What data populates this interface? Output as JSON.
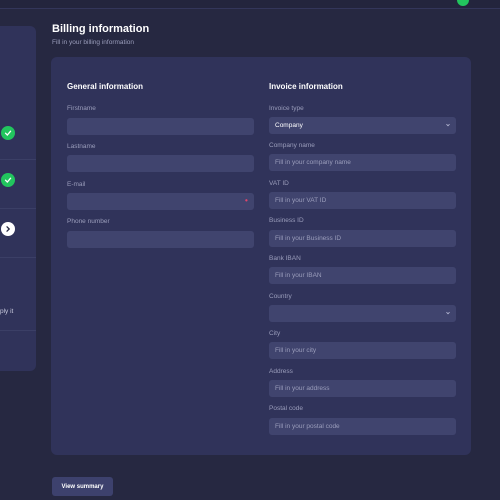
{
  "header": {
    "title": "Billing information",
    "subtitle": "Fill in your billing information"
  },
  "steps_panel": {
    "partial_text": "ply it"
  },
  "general": {
    "title": "General information",
    "fields": [
      {
        "label": "Firstname",
        "value": ""
      },
      {
        "label": "Lastname",
        "value": ""
      },
      {
        "label": "E-mail",
        "value": ""
      },
      {
        "label": "Phone number",
        "value": ""
      }
    ]
  },
  "invoice": {
    "title": "Invoice information",
    "invoice_type": {
      "label": "Invoice type",
      "value": "Company"
    },
    "company_name": {
      "label": "Company name",
      "placeholder": "Fill in your company name"
    },
    "vat_id": {
      "label": "VAT ID",
      "placeholder": "Fill in your VAT ID"
    },
    "business_id": {
      "label": "Business ID",
      "placeholder": "Fill in your Business ID"
    },
    "bank_iban": {
      "label": "Bank IBAN",
      "placeholder": "Fill in your IBAN"
    },
    "country": {
      "label": "Country",
      "value": ""
    },
    "city": {
      "label": "City",
      "placeholder": "Fill in your city"
    },
    "address": {
      "label": "Address",
      "placeholder": "Fill in your address"
    },
    "postal_code": {
      "label": "Postal code",
      "placeholder": "Fill in your postal code"
    }
  },
  "actions": {
    "view_summary": "View summary"
  },
  "colors": {
    "background": "#262841",
    "card": "#30335a",
    "input": "#40446e",
    "success": "#22c55e",
    "error": "#e0456b"
  }
}
